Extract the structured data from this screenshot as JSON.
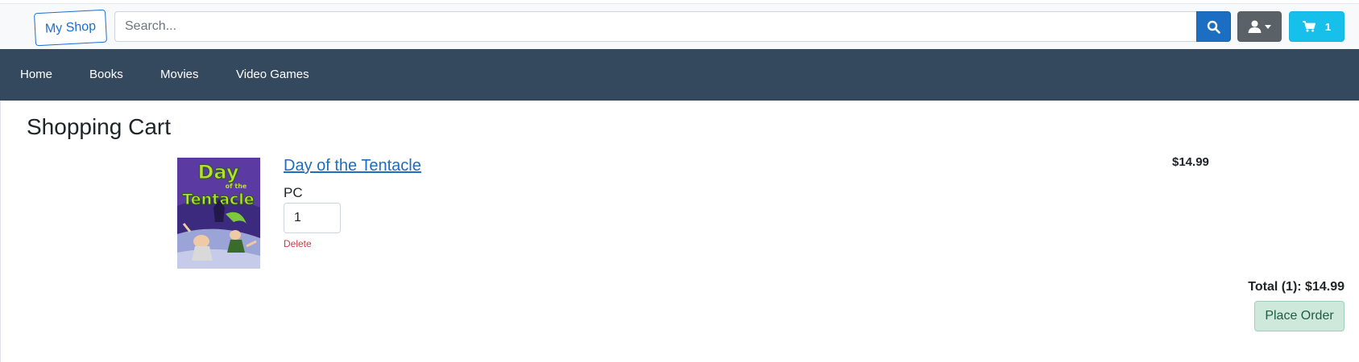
{
  "header": {
    "logo": "My Shop",
    "search_placeholder": "Search...",
    "search_icon": "search-icon",
    "user_icon": "user-icon",
    "cart": {
      "icon": "cart-icon",
      "count": "1"
    }
  },
  "nav": {
    "items": [
      {
        "label": "Home"
      },
      {
        "label": "Books"
      },
      {
        "label": "Movies"
      },
      {
        "label": "Video Games"
      }
    ]
  },
  "page": {
    "title": "Shopping Cart"
  },
  "cart_items": [
    {
      "name": "Day of the Tentacle",
      "platform": "PC",
      "quantity": "1",
      "delete_label": "Delete",
      "price": "$14.99",
      "cover_text_1": "Day",
      "cover_text_2": "of the",
      "cover_text_3": "Tentacle"
    }
  ],
  "summary": {
    "total": "Total (1): $14.99",
    "place_order_label": "Place Order"
  },
  "colors": {
    "primary": "#1b6ec2",
    "nav_bg": "#34495e",
    "cart_button": "#17c0eb",
    "danger": "#dc3545",
    "success_light": "#cfe8dc"
  }
}
